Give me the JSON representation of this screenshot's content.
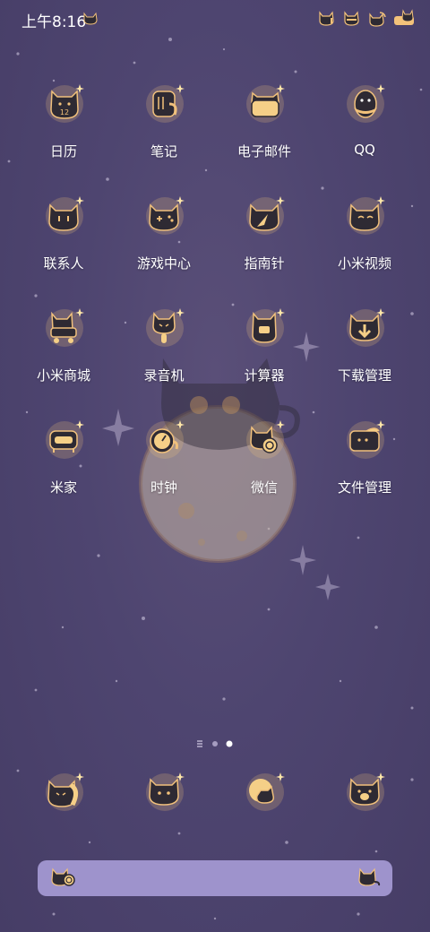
{
  "status_bar": {
    "time": "上午8:16"
  },
  "apps": [
    {
      "id": "calendar",
      "label": "日历",
      "icon": "calendar-cat-icon",
      "badge_text": "12"
    },
    {
      "id": "notes",
      "label": "笔记",
      "icon": "notes-cat-icon"
    },
    {
      "id": "email",
      "label": "电子邮件",
      "icon": "email-cat-icon"
    },
    {
      "id": "qq",
      "label": "QQ",
      "icon": "penguin-cat-icon"
    },
    {
      "id": "contacts",
      "label": "联系人",
      "icon": "contacts-cat-icon"
    },
    {
      "id": "games",
      "label": "游戏中心",
      "icon": "game-cat-icon"
    },
    {
      "id": "compass",
      "label": "指南针",
      "icon": "compass-cat-icon"
    },
    {
      "id": "video",
      "label": "小米视频",
      "icon": "video-cat-icon"
    },
    {
      "id": "mall",
      "label": "小米商城",
      "icon": "cart-cat-icon"
    },
    {
      "id": "recorder",
      "label": "录音机",
      "icon": "microphone-cat-icon"
    },
    {
      "id": "calculator",
      "label": "计算器",
      "icon": "calculator-cat-icon"
    },
    {
      "id": "downloads",
      "label": "下载管理",
      "icon": "download-cat-icon"
    },
    {
      "id": "mihome",
      "label": "米家",
      "icon": "sofa-cat-icon"
    },
    {
      "id": "clock",
      "label": "时钟",
      "icon": "clock-cat-icon"
    },
    {
      "id": "wechat",
      "label": "微信",
      "icon": "wechat-cat-icon"
    },
    {
      "id": "files",
      "label": "文件管理",
      "icon": "folder-cat-icon"
    }
  ],
  "dock": [
    {
      "id": "phone",
      "icon": "phone-cat-icon"
    },
    {
      "id": "messages",
      "icon": "message-cat-icon"
    },
    {
      "id": "browser",
      "icon": "moon-cat-icon"
    },
    {
      "id": "camera",
      "icon": "camera-cat-icon"
    }
  ],
  "page_indicator": {
    "pages": 3,
    "current": 3
  },
  "colors": {
    "background": "#4e4570",
    "icon_glow": "#f3c27a",
    "cat": "#2e2a33",
    "search_bar": "#9e93cc"
  }
}
